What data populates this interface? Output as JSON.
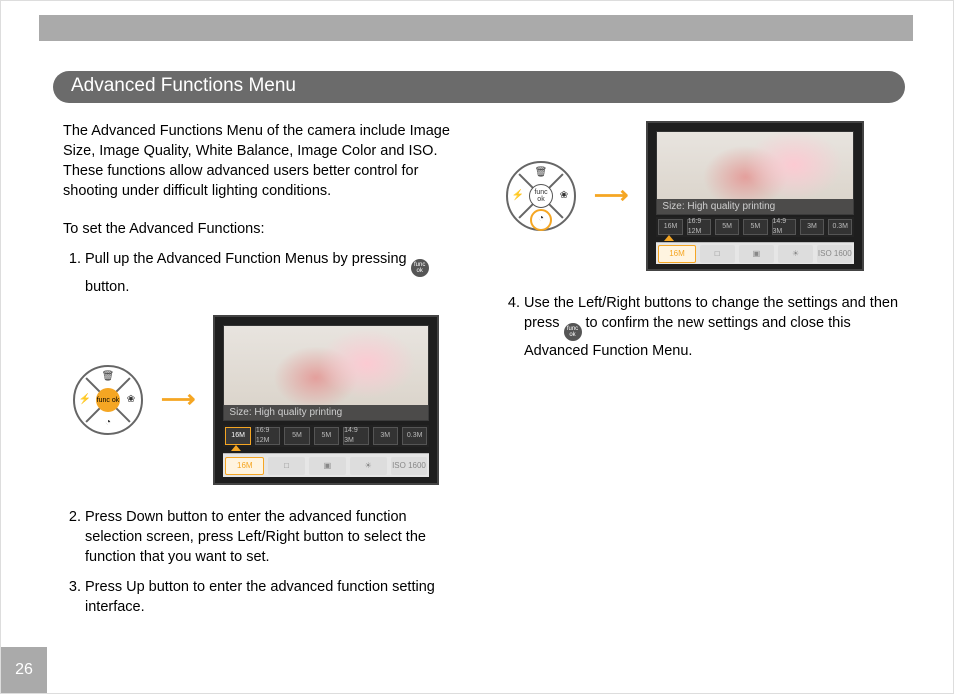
{
  "page_number": "26",
  "section_title": "Advanced Functions Menu",
  "intro": "The Advanced Functions Menu of the camera include Image Size, Image Quality, White Balance, Image Color and ISO. These functions allow advanced users better control for shooting under difficult lighting conditions.",
  "subhead": "To set the Advanced Functions:",
  "steps": {
    "s1a": "Pull up the Advanced Function Menus by pressing ",
    "s1b": " button.",
    "s2": "Press Down button to enter the advanced function selection screen, press Left/Right button to select the function that you want to set.",
    "s3": "Press Up button to enter the advanced function setting interface.",
    "s4a": "Use the Left/Right buttons to change the settings and then press ",
    "s4b": " to confirm the new settings and close this Advanced Function Menu."
  },
  "button_label": "func ok",
  "screen": {
    "caption": "Size: High quality printing",
    "options": [
      "16M",
      "16:9 12M",
      "5M",
      "5M",
      "14:9 3M",
      "3M",
      "0.3M"
    ],
    "funcs": [
      "16M",
      "□",
      "▣",
      "☀",
      "ISO 1600"
    ]
  }
}
